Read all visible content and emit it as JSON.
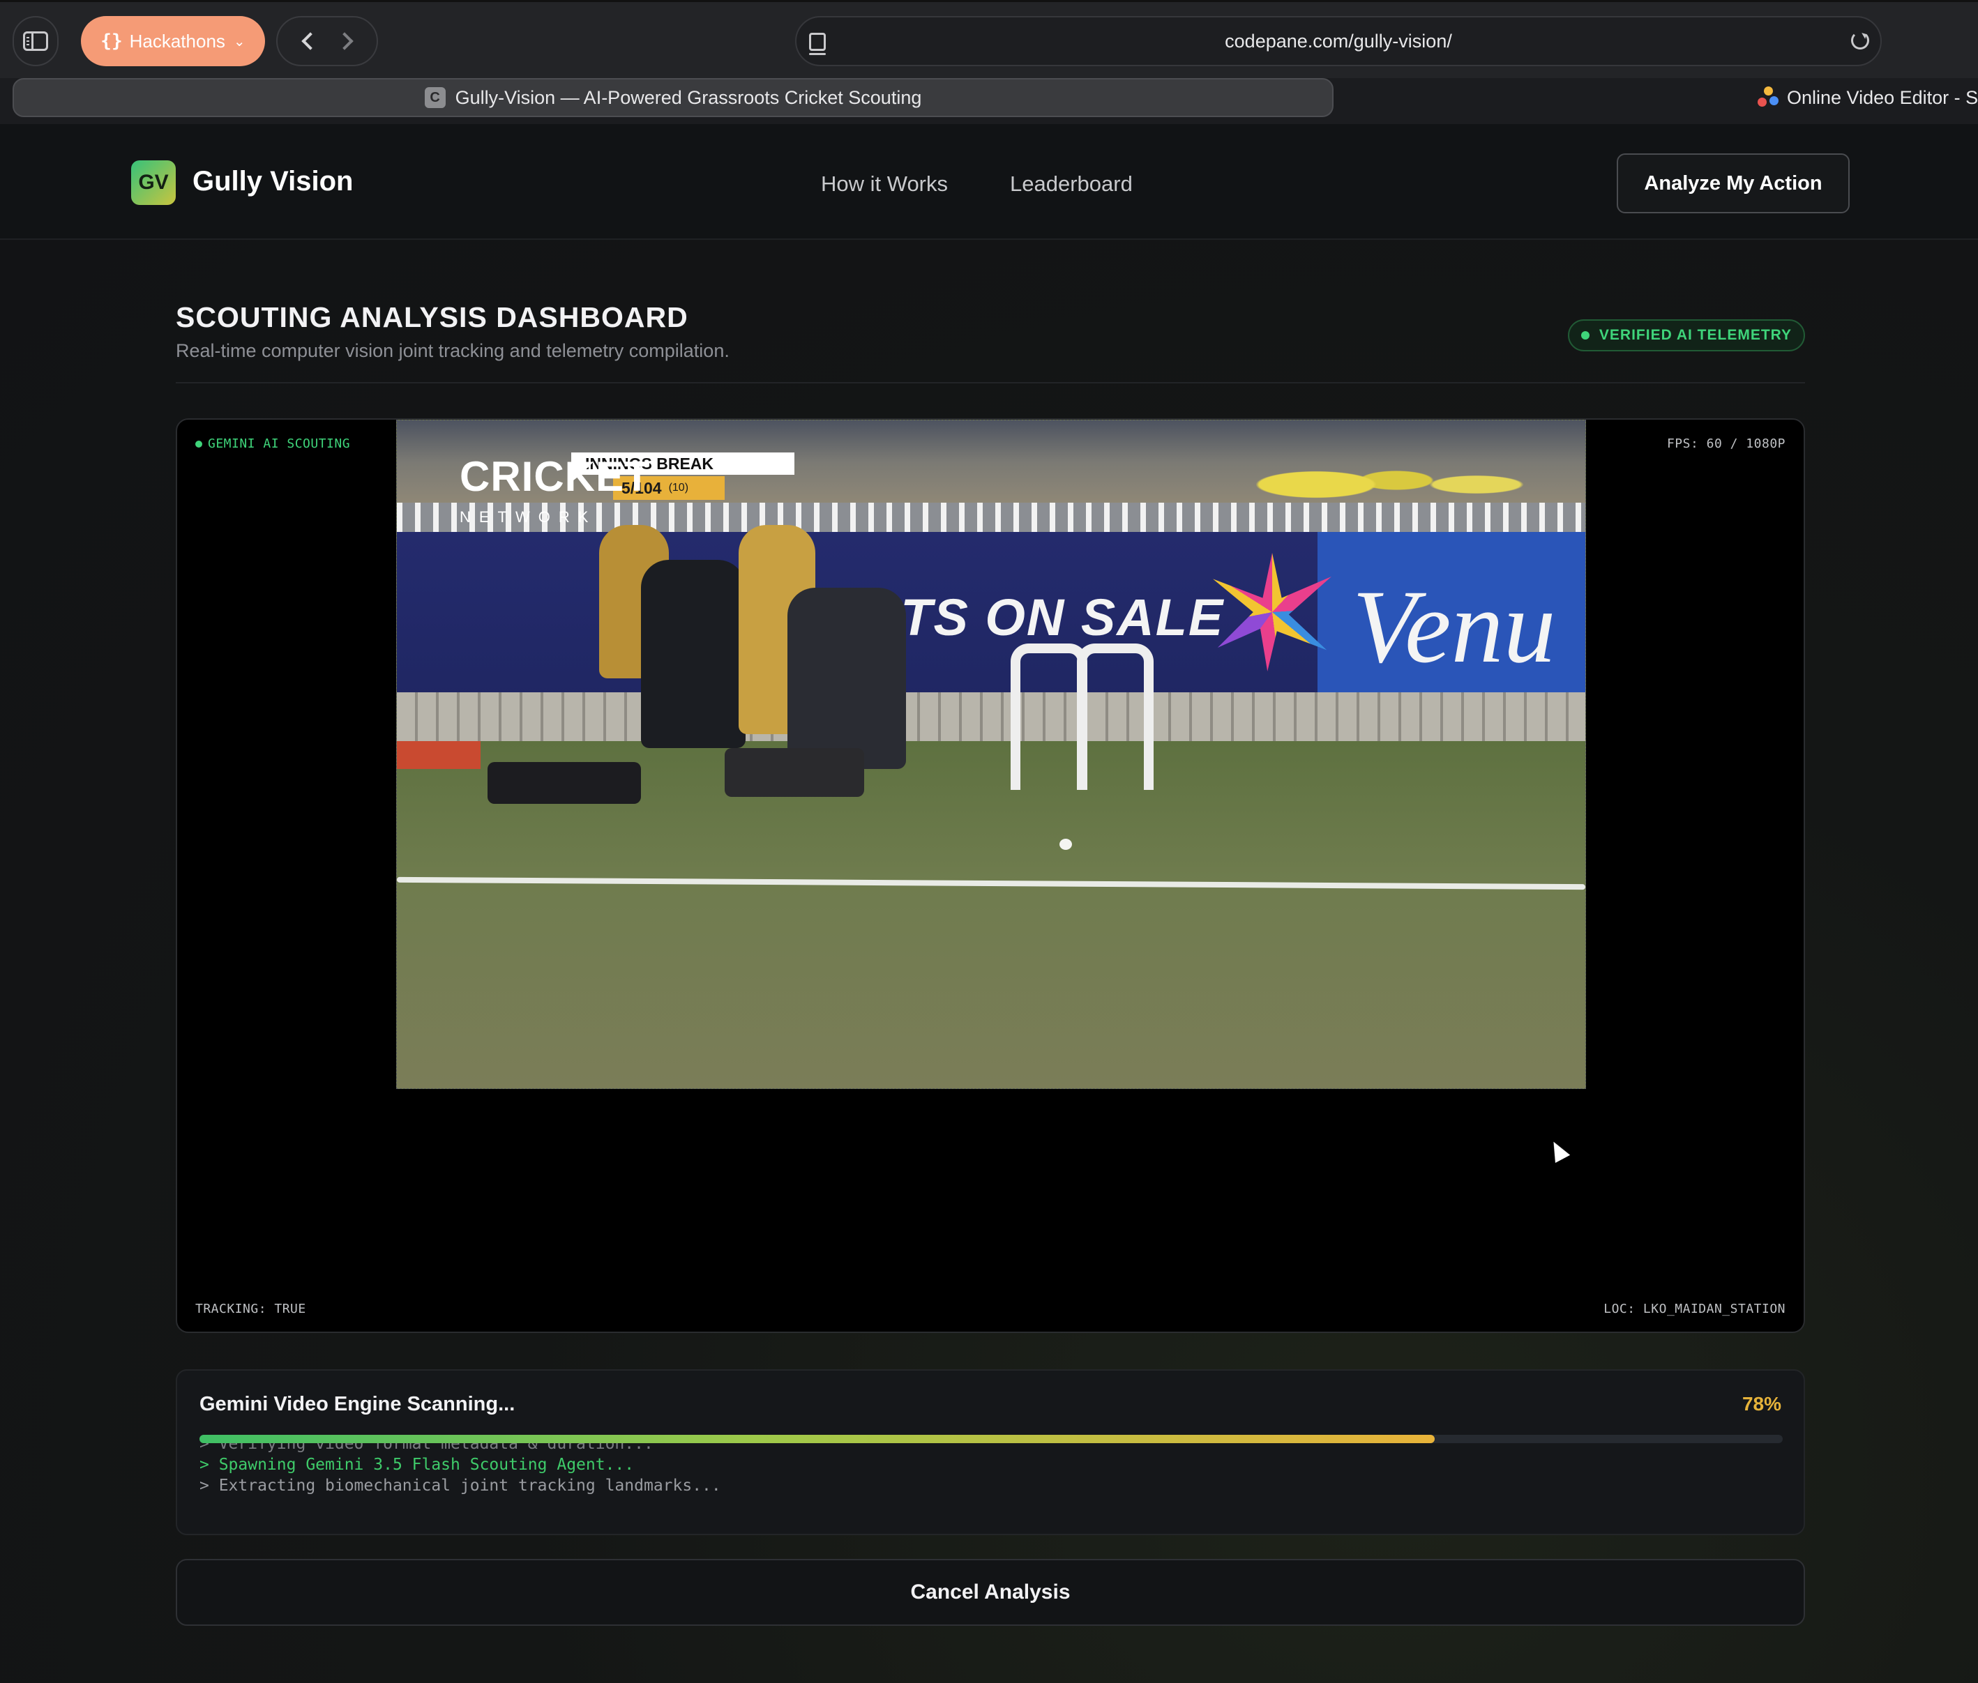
{
  "browser": {
    "tab_group_label": "Hackathons",
    "address": "codepane.com/gully-vision/",
    "active_tab_title": "Gully-Vision — AI-Powered Grassroots Cricket Scouting",
    "active_tab_favicon": "C",
    "other_tab_title": "Online Video Editor - S"
  },
  "nav": {
    "logo_mark": "GV",
    "brand": "Gully Vision",
    "links": [
      "How it Works",
      "Leaderboard"
    ],
    "cta": "Analyze My Action"
  },
  "dashboard": {
    "title": "SCOUTING ANALYSIS DASHBOARD",
    "subtitle": "Real-time computer vision joint tracking and telemetry compilation.",
    "badge": "VERIFIED AI TELEMETRY"
  },
  "video": {
    "top_left": "GEMINI AI SCOUTING",
    "top_right": "FPS: 60 / 1080P",
    "bottom_left": "TRACKING: TRUE",
    "bottom_right": "LOC: LKO_MAIDAN_STATION",
    "broadcast": {
      "logo": "CRICKET",
      "network": "NETWORK",
      "status": "INNINGS BREAK",
      "score": "5/104",
      "overs": "(10)"
    },
    "banner_text": "CKETS ON SALE",
    "venue_text": "Venu"
  },
  "progress": {
    "title": "Gemini Video Engine Scanning...",
    "percent_label": "78%",
    "percent": 78,
    "logs": [
      "> Verifying video format metadata & duration...",
      "> Spawning Gemini 3.5 Flash Scouting Agent...",
      "> Extracting biomechanical joint tracking landmarks..."
    ]
  },
  "cancel_label": "Cancel Analysis",
  "colors": {
    "accent_green": "#3fd47a",
    "accent_orange": "#f59b76",
    "progress_amber": "#e6b33a"
  }
}
